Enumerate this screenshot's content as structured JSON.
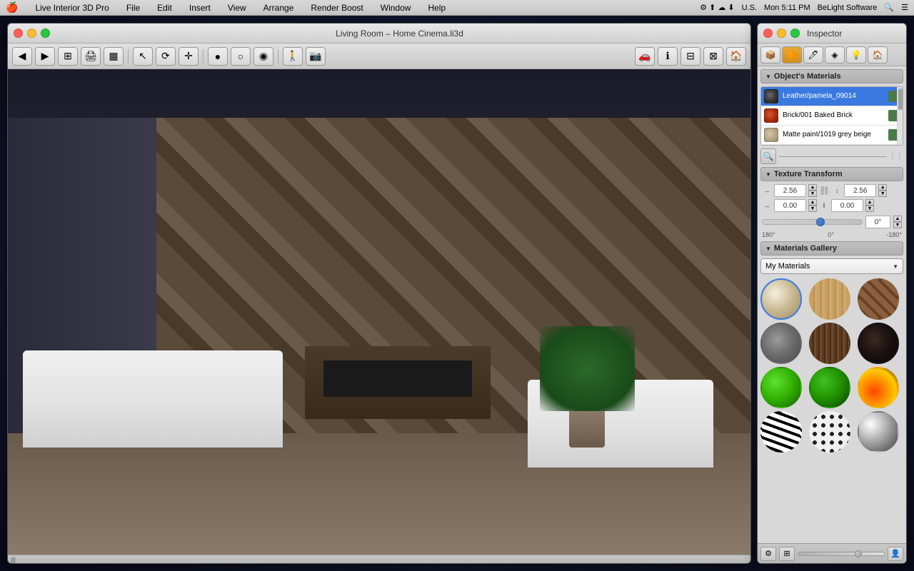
{
  "menubar": {
    "apple": "🍎",
    "app_name": "Live Interior 3D Pro",
    "menus": [
      "File",
      "Edit",
      "Insert",
      "View",
      "Arrange",
      "Render Boost",
      "Window",
      "Help"
    ],
    "right": {
      "time": "Mon 5:11 PM",
      "brand": "BeLight Software",
      "locale": "U.S."
    }
  },
  "main_window": {
    "title": "Living Room – Home Cinema.li3d",
    "traffic_lights": {
      "close": "close",
      "minimize": "minimize",
      "maximize": "maximize"
    }
  },
  "inspector": {
    "title": "Inspector",
    "tabs": [
      {
        "id": "object",
        "icon": "📦",
        "active": false
      },
      {
        "id": "material",
        "icon": "🔶",
        "active": true
      },
      {
        "id": "paint",
        "icon": "🖊",
        "active": false
      },
      {
        "id": "texture",
        "icon": "⬡",
        "active": false
      },
      {
        "id": "light",
        "icon": "💡",
        "active": false
      },
      {
        "id": "house",
        "icon": "🏠",
        "active": false
      }
    ],
    "objects_materials": {
      "section_title": "Object's Materials",
      "materials": [
        {
          "name": "Leather/pamela_09014",
          "swatch_color": "#4a4a4a",
          "selected": true
        },
        {
          "name": "Brick/001 Baked Brick",
          "swatch_color": "#cc4422",
          "selected": false
        },
        {
          "name": "Matte paint/1019 grey beige",
          "swatch_color": "#c8b89a",
          "selected": false
        }
      ]
    },
    "texture_transform": {
      "section_title": "Texture Transform",
      "width_value": "2.56",
      "height_value": "2.56",
      "offset_x": "0.00",
      "offset_y": "0.00",
      "rotation_value": "0°",
      "rotation_min": "180°",
      "rotation_mid": "0°",
      "rotation_max": "-180°"
    },
    "materials_gallery": {
      "section_title": "Materials Gallery",
      "dropdown_value": "My Materials",
      "materials": [
        {
          "id": 1,
          "style": "mat-cream",
          "selected": true,
          "label": "Cream fabric"
        },
        {
          "id": 2,
          "style": "mat-wood-light",
          "selected": false,
          "label": "Light wood"
        },
        {
          "id": 3,
          "style": "mat-brick",
          "selected": false,
          "label": "Brick"
        },
        {
          "id": 4,
          "style": "mat-stone",
          "selected": false,
          "label": "Stone"
        },
        {
          "id": 5,
          "style": "mat-dark-wood",
          "selected": false,
          "label": "Dark wood"
        },
        {
          "id": 6,
          "style": "mat-very-dark",
          "selected": false,
          "label": "Very dark"
        },
        {
          "id": 7,
          "style": "mat-green-bright",
          "selected": false,
          "label": "Bright green"
        },
        {
          "id": 8,
          "style": "mat-green-dark",
          "selected": false,
          "label": "Dark green"
        },
        {
          "id": 9,
          "style": "mat-fire",
          "selected": false,
          "label": "Fire"
        },
        {
          "id": 10,
          "style": "mat-zebra",
          "selected": false,
          "label": "Zebra"
        },
        {
          "id": 11,
          "style": "mat-spots",
          "selected": false,
          "label": "Spots"
        },
        {
          "id": 12,
          "style": "mat-chrome",
          "selected": false,
          "label": "Chrome"
        }
      ]
    }
  },
  "statusbar": {
    "text": "|||"
  }
}
